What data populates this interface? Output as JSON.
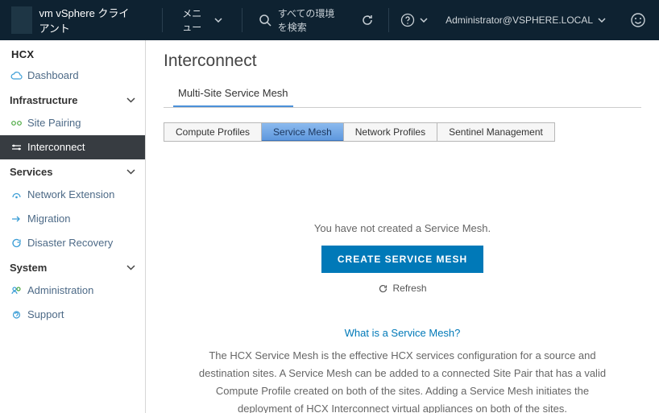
{
  "topbar": {
    "title": "vm vSphere クライアント",
    "menu_label": "メニュー",
    "search_placeholder": "すべての環境を検索",
    "user_label": "Administrator@VSPHERE.LOCAL"
  },
  "sidebar": {
    "app": "HCX",
    "items": [
      {
        "key": "dashboard",
        "label": "Dashboard"
      }
    ],
    "sections": [
      {
        "title": "Infrastructure",
        "items": [
          {
            "key": "site-pairing",
            "label": "Site Pairing"
          },
          {
            "key": "interconnect",
            "label": "Interconnect",
            "active": true
          }
        ]
      },
      {
        "title": "Services",
        "items": [
          {
            "key": "network-extension",
            "label": "Network Extension"
          },
          {
            "key": "migration",
            "label": "Migration"
          },
          {
            "key": "disaster-recovery",
            "label": "Disaster Recovery"
          }
        ]
      },
      {
        "title": "System",
        "items": [
          {
            "key": "administration",
            "label": "Administration"
          },
          {
            "key": "support",
            "label": "Support"
          }
        ]
      }
    ]
  },
  "page": {
    "title": "Interconnect",
    "sub_tab": "Multi-Site Service Mesh",
    "segmented_tabs": [
      {
        "key": "compute-profiles",
        "label": "Compute Profiles"
      },
      {
        "key": "service-mesh",
        "label": "Service Mesh",
        "selected": true
      },
      {
        "key": "network-profiles",
        "label": "Network Profiles"
      },
      {
        "key": "sentinel-management",
        "label": "Sentinel Management"
      }
    ],
    "empty": {
      "message": "You have not created a Service Mesh.",
      "button": "CREATE SERVICE MESH",
      "refresh": "Refresh"
    },
    "info": {
      "heading": "What is a Service Mesh?",
      "body": "The HCX Service Mesh is the effective HCX services configuration for a source and destination sites. A Service Mesh can be added to a connected Site Pair that has a valid Compute Profile created on both of the sites. Adding a Service Mesh initiates the deployment of HCX Interconnect virtual appliances on both of the sites."
    }
  }
}
